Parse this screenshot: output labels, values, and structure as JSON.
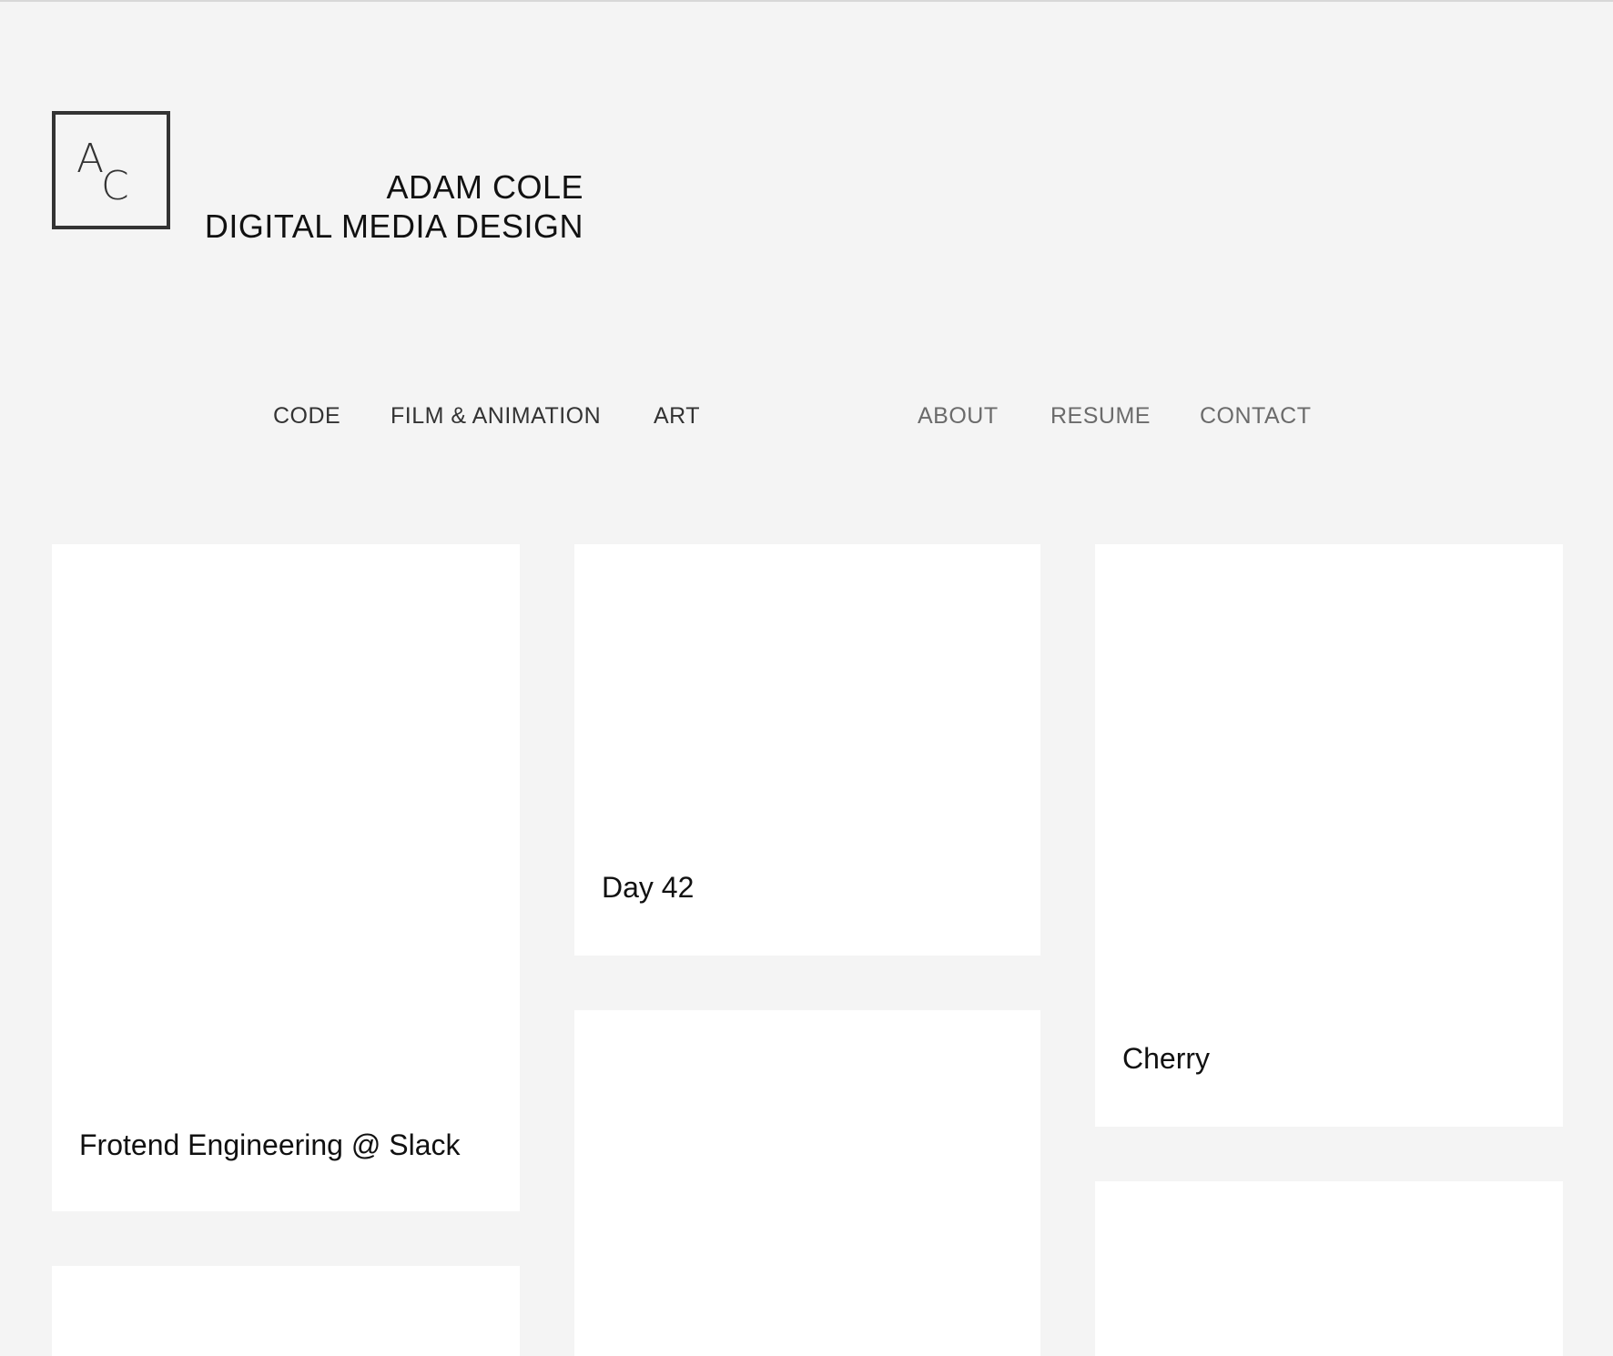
{
  "logo": {
    "letter_top": "A",
    "letter_bottom": "C"
  },
  "site_title": {
    "line1": "ADAM COLE",
    "line2": "DIGITAL MEDIA DESIGN"
  },
  "nav": {
    "primary": [
      {
        "label": "CODE"
      },
      {
        "label": "FILM & ANIMATION"
      },
      {
        "label": "ART"
      }
    ],
    "secondary": [
      {
        "label": "ABOUT"
      },
      {
        "label": "RESUME"
      },
      {
        "label": "CONTACT"
      }
    ]
  },
  "projects": [
    {
      "title": "Frotend Engineering @ Slack"
    },
    {
      "title": "Day 42"
    },
    {
      "title": "Cherry"
    },
    {
      "title": ""
    },
    {
      "title": ""
    },
    {
      "title": ""
    }
  ],
  "colors": {
    "background": "#f4f4f4",
    "tile": "#ffffff",
    "nav_primary": "#333333",
    "nav_secondary": "#6b6b6b",
    "logo_border": "#333333"
  }
}
